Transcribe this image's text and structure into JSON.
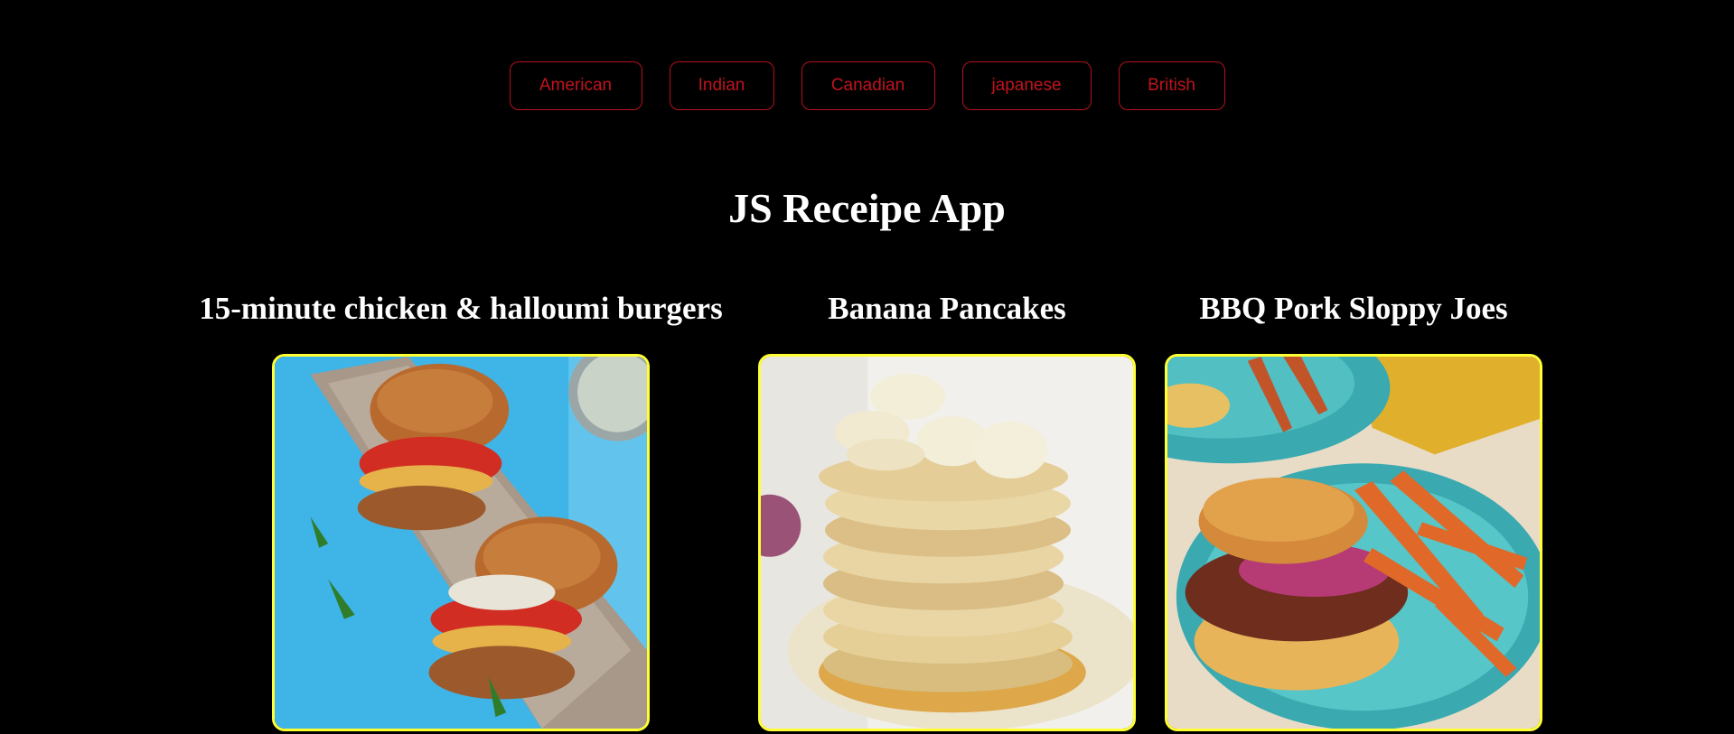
{
  "filters": [
    {
      "label": "American"
    },
    {
      "label": "Indian"
    },
    {
      "label": "Canadian"
    },
    {
      "label": "japanese"
    },
    {
      "label": "British"
    }
  ],
  "app_title": "JS Receipe App",
  "recipes": [
    {
      "title": "15-minute chicken & halloumi burgers",
      "image_icon": "burger-photo"
    },
    {
      "title": "Banana Pancakes",
      "image_icon": "pancake-photo"
    },
    {
      "title": "BBQ Pork Sloppy Joes",
      "image_icon": "sloppy-joe-photo"
    }
  ],
  "colors": {
    "background": "#000000",
    "filter_accent": "#b5121b",
    "image_border": "#ffff33",
    "title_text": "#ffffff"
  }
}
